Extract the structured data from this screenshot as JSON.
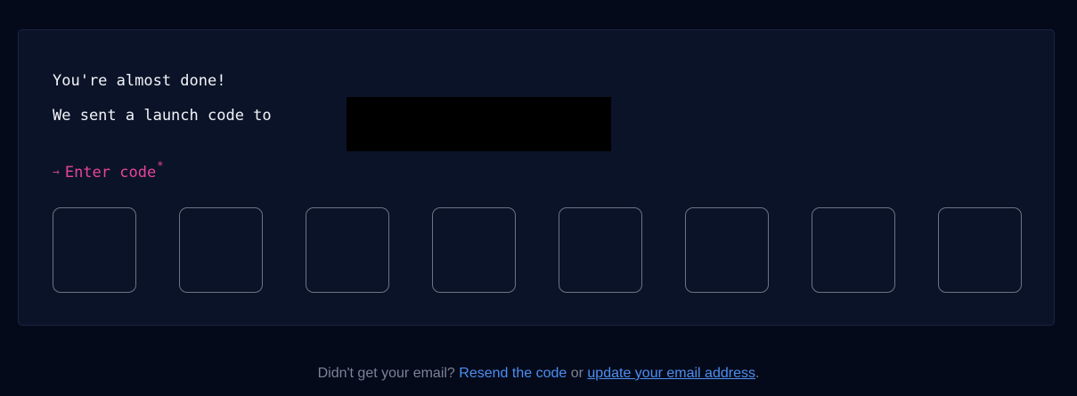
{
  "card": {
    "heading": "You're almost done!",
    "sent_prefix": "We sent a launch code to",
    "code_label": {
      "arrow": "→",
      "text": "Enter code",
      "required_mark": "*"
    },
    "code_inputs": [
      "",
      "",
      "",
      "",
      "",
      "",
      "",
      ""
    ]
  },
  "footer": {
    "question": "Didn't get your email?",
    "resend_link": "Resend the code",
    "or_text": "or",
    "update_link": "update your email address",
    "period": "."
  },
  "colors": {
    "page_background": "#050a1b",
    "card_background": "#0b1328",
    "accent_pink": "#e8449a",
    "link_blue": "#4d8ff0"
  },
  "icons": {
    "label_arrow": "arrow-right-icon"
  }
}
